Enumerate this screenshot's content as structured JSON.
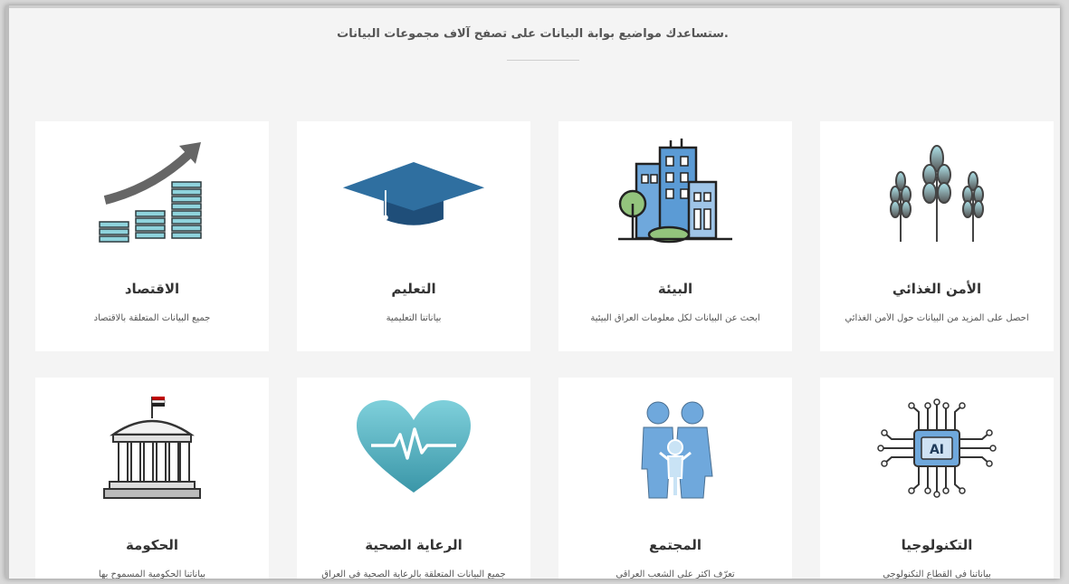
{
  "intro": ".ستساعدك مواضيع بوابة البيانات على تصفح آلاف مجموعات البيانات",
  "cards": [
    {
      "title": "الأمن الغذائي",
      "desc": "احصل على المزيد من البيانات حول الأمن الغذائي",
      "icon": "wheat-icon"
    },
    {
      "title": "البيئة",
      "desc": "ابحث عن البيانات لكل معلومات العراق البيئية",
      "icon": "city-buildings-icon"
    },
    {
      "title": "التعليم",
      "desc": "بياناتنا التعليمية",
      "icon": "graduation-cap-icon"
    },
    {
      "title": "الاقتصاد",
      "desc": "جميع البيانات المتعلقة بالاقتصاد",
      "icon": "growth-chart-icon"
    },
    {
      "title": "التكنولوجيا",
      "desc": "بياناتنا في القطاع التكنولوجي",
      "icon": "ai-chip-icon"
    },
    {
      "title": "المجتمع",
      "desc": "تعرّف اكثر على الشعب العراقي",
      "icon": "family-icon"
    },
    {
      "title": "الرعاية الصحية",
      "desc": "جميع البيانات المتعلقة بالرعاية الصحية في العراق",
      "icon": "heartbeat-icon"
    },
    {
      "title": "الحكومة",
      "desc": "بياناتنا الحكومية المسموح بها",
      "icon": "government-building-icon"
    }
  ],
  "colors": {
    "blue": "#2f6fa0",
    "teal": "#5bbfc9",
    "gray": "#6d6d6d"
  }
}
